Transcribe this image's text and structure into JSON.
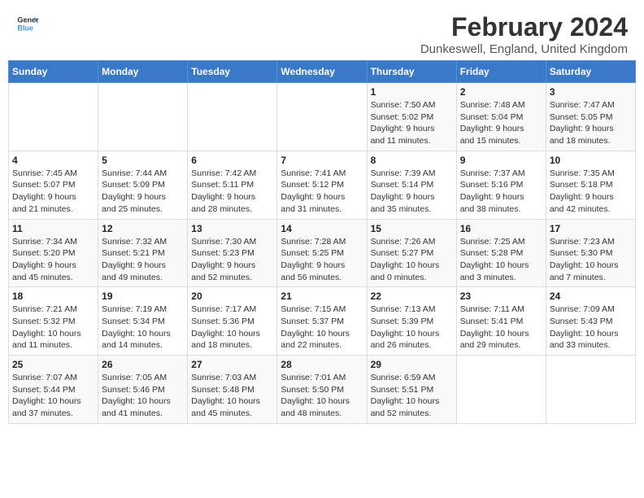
{
  "header": {
    "logo_line1": "General",
    "logo_line2": "Blue",
    "title": "February 2024",
    "subtitle": "Dunkeswell, England, United Kingdom"
  },
  "calendar": {
    "days_of_week": [
      "Sunday",
      "Monday",
      "Tuesday",
      "Wednesday",
      "Thursday",
      "Friday",
      "Saturday"
    ],
    "weeks": [
      [
        {
          "day": "",
          "info": ""
        },
        {
          "day": "",
          "info": ""
        },
        {
          "day": "",
          "info": ""
        },
        {
          "day": "",
          "info": ""
        },
        {
          "day": "1",
          "info": "Sunrise: 7:50 AM\nSunset: 5:02 PM\nDaylight: 9 hours\nand 11 minutes."
        },
        {
          "day": "2",
          "info": "Sunrise: 7:48 AM\nSunset: 5:04 PM\nDaylight: 9 hours\nand 15 minutes."
        },
        {
          "day": "3",
          "info": "Sunrise: 7:47 AM\nSunset: 5:05 PM\nDaylight: 9 hours\nand 18 minutes."
        }
      ],
      [
        {
          "day": "4",
          "info": "Sunrise: 7:45 AM\nSunset: 5:07 PM\nDaylight: 9 hours\nand 21 minutes."
        },
        {
          "day": "5",
          "info": "Sunrise: 7:44 AM\nSunset: 5:09 PM\nDaylight: 9 hours\nand 25 minutes."
        },
        {
          "day": "6",
          "info": "Sunrise: 7:42 AM\nSunset: 5:11 PM\nDaylight: 9 hours\nand 28 minutes."
        },
        {
          "day": "7",
          "info": "Sunrise: 7:41 AM\nSunset: 5:12 PM\nDaylight: 9 hours\nand 31 minutes."
        },
        {
          "day": "8",
          "info": "Sunrise: 7:39 AM\nSunset: 5:14 PM\nDaylight: 9 hours\nand 35 minutes."
        },
        {
          "day": "9",
          "info": "Sunrise: 7:37 AM\nSunset: 5:16 PM\nDaylight: 9 hours\nand 38 minutes."
        },
        {
          "day": "10",
          "info": "Sunrise: 7:35 AM\nSunset: 5:18 PM\nDaylight: 9 hours\nand 42 minutes."
        }
      ],
      [
        {
          "day": "11",
          "info": "Sunrise: 7:34 AM\nSunset: 5:20 PM\nDaylight: 9 hours\nand 45 minutes."
        },
        {
          "day": "12",
          "info": "Sunrise: 7:32 AM\nSunset: 5:21 PM\nDaylight: 9 hours\nand 49 minutes."
        },
        {
          "day": "13",
          "info": "Sunrise: 7:30 AM\nSunset: 5:23 PM\nDaylight: 9 hours\nand 52 minutes."
        },
        {
          "day": "14",
          "info": "Sunrise: 7:28 AM\nSunset: 5:25 PM\nDaylight: 9 hours\nand 56 minutes."
        },
        {
          "day": "15",
          "info": "Sunrise: 7:26 AM\nSunset: 5:27 PM\nDaylight: 10 hours\nand 0 minutes."
        },
        {
          "day": "16",
          "info": "Sunrise: 7:25 AM\nSunset: 5:28 PM\nDaylight: 10 hours\nand 3 minutes."
        },
        {
          "day": "17",
          "info": "Sunrise: 7:23 AM\nSunset: 5:30 PM\nDaylight: 10 hours\nand 7 minutes."
        }
      ],
      [
        {
          "day": "18",
          "info": "Sunrise: 7:21 AM\nSunset: 5:32 PM\nDaylight: 10 hours\nand 11 minutes."
        },
        {
          "day": "19",
          "info": "Sunrise: 7:19 AM\nSunset: 5:34 PM\nDaylight: 10 hours\nand 14 minutes."
        },
        {
          "day": "20",
          "info": "Sunrise: 7:17 AM\nSunset: 5:36 PM\nDaylight: 10 hours\nand 18 minutes."
        },
        {
          "day": "21",
          "info": "Sunrise: 7:15 AM\nSunset: 5:37 PM\nDaylight: 10 hours\nand 22 minutes."
        },
        {
          "day": "22",
          "info": "Sunrise: 7:13 AM\nSunset: 5:39 PM\nDaylight: 10 hours\nand 26 minutes."
        },
        {
          "day": "23",
          "info": "Sunrise: 7:11 AM\nSunset: 5:41 PM\nDaylight: 10 hours\nand 29 minutes."
        },
        {
          "day": "24",
          "info": "Sunrise: 7:09 AM\nSunset: 5:43 PM\nDaylight: 10 hours\nand 33 minutes."
        }
      ],
      [
        {
          "day": "25",
          "info": "Sunrise: 7:07 AM\nSunset: 5:44 PM\nDaylight: 10 hours\nand 37 minutes."
        },
        {
          "day": "26",
          "info": "Sunrise: 7:05 AM\nSunset: 5:46 PM\nDaylight: 10 hours\nand 41 minutes."
        },
        {
          "day": "27",
          "info": "Sunrise: 7:03 AM\nSunset: 5:48 PM\nDaylight: 10 hours\nand 45 minutes."
        },
        {
          "day": "28",
          "info": "Sunrise: 7:01 AM\nSunset: 5:50 PM\nDaylight: 10 hours\nand 48 minutes."
        },
        {
          "day": "29",
          "info": "Sunrise: 6:59 AM\nSunset: 5:51 PM\nDaylight: 10 hours\nand 52 minutes."
        },
        {
          "day": "",
          "info": ""
        },
        {
          "day": "",
          "info": ""
        }
      ]
    ]
  }
}
